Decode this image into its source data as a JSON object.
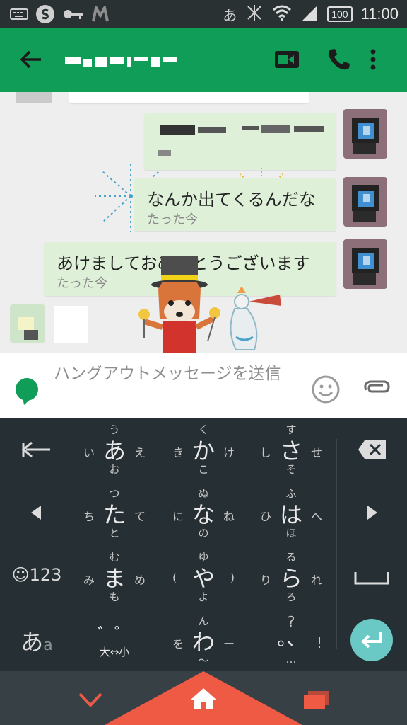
{
  "status_bar": {
    "input_mode": "あ",
    "battery": "100",
    "time": "11:00"
  },
  "app_bar": {
    "back_icon": "arrow-left-icon",
    "video_icon": "video-call-icon",
    "call_icon": "phone-icon",
    "menu_icon": "overflow-menu-icon",
    "color": "#109d58"
  },
  "messages": [
    {
      "text": "なんか出てくるんだな",
      "time": "たった今"
    },
    {
      "text": "あけましておめでとうございます",
      "time": "たった今"
    }
  ],
  "compose": {
    "placeholder": "ハングアウトメッセージを送信"
  },
  "keyboard": {
    "left_keys": {
      "back": "←",
      "left": "◀",
      "emoji": "☺123",
      "mode": "あ",
      "mode_small": "a"
    },
    "right_keys": {
      "delete": "✕",
      "right": "▶",
      "space": "⎵",
      "enter": "↵"
    },
    "keys": [
      {
        "main": "あ",
        "up": "う",
        "down": "お",
        "left": "い",
        "right": "え"
      },
      {
        "main": "か",
        "up": "く",
        "down": "こ",
        "left": "き",
        "right": "け"
      },
      {
        "main": "さ",
        "up": "す",
        "down": "そ",
        "left": "し",
        "right": "せ"
      },
      {
        "main": "た",
        "up": "つ",
        "down": "と",
        "left": "ち",
        "right": "て"
      },
      {
        "main": "な",
        "up": "ぬ",
        "down": "の",
        "left": "に",
        "right": "ね"
      },
      {
        "main": "は",
        "up": "ふ",
        "down": "ほ",
        "left": "ひ",
        "right": "へ"
      },
      {
        "main": "ま",
        "up": "む",
        "down": "も",
        "left": "み",
        "right": "め"
      },
      {
        "main": "や",
        "up": "ゆ",
        "down": "よ",
        "left": "(",
        "right": ")"
      },
      {
        "main": "ら",
        "up": "る",
        "down": "ろ",
        "left": "り",
        "right": "れ"
      },
      {
        "main": "゛゜",
        "up": "",
        "down": "大⇔小",
        "left": "",
        "right": ""
      },
      {
        "main": "わ",
        "up": "ん",
        "down": "〜",
        "left": "を",
        "right": "ー"
      },
      {
        "main": "。、",
        "up": "?",
        "down": "…",
        "left": "",
        "right": "!"
      }
    ]
  },
  "nav_bar": {
    "hide_icon": "chevron-down-icon",
    "home_icon": "home-icon",
    "recents_icon": "recents-icon",
    "accent": "#ef5a44"
  }
}
